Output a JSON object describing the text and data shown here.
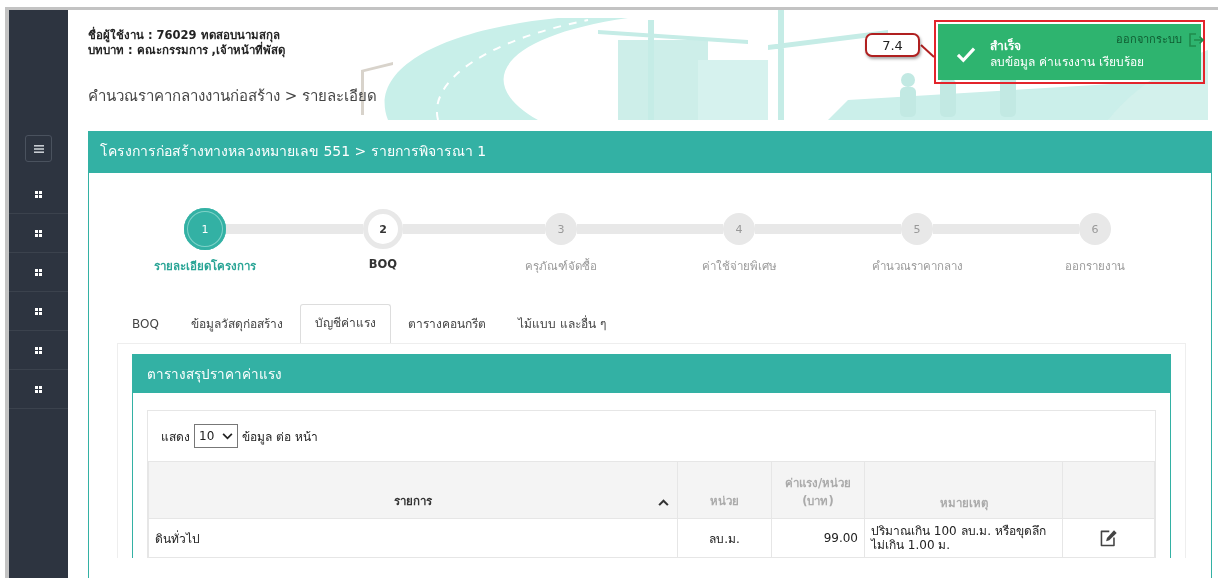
{
  "user": {
    "name_label": "ชื่อผู้ใช้งาน : 76029 ทดสอบนามสกุล",
    "role_label": "บทบาท : คณะกรรมการ ,เจ้าหน้าที่พัสดุ"
  },
  "breadcrumb": "คำนวณราคากลางงานก่อสร้าง > รายละเอียด",
  "logout": "ออกจากระบบ",
  "toast": {
    "title": "สำเร็จ",
    "message": "ลบข้อมูล ค่าแรงงาน เรียบร้อย"
  },
  "annotation": {
    "label": "7.4"
  },
  "panel": {
    "title": "โครงการก่อสร้างทางหลวงหมายเลข 551 > รายการพิจารณา 1"
  },
  "steps": [
    {
      "number": "1",
      "label": "รายละเอียดโครงการ",
      "selected": true,
      "disabled": false
    },
    {
      "number": "2",
      "label": "BOQ",
      "selected": false,
      "disabled": false
    },
    {
      "number": "3",
      "label": "ครุภัณฑ์จัดซื้อ",
      "selected": false,
      "disabled": true
    },
    {
      "number": "4",
      "label": "ค่าใช้จ่ายพิเศษ",
      "selected": false,
      "disabled": true
    },
    {
      "number": "5",
      "label": "คำนวณราคากลาง",
      "selected": false,
      "disabled": true
    },
    {
      "number": "6",
      "label": "ออกรายงาน",
      "selected": false,
      "disabled": true
    }
  ],
  "tabs": [
    {
      "label": "BOQ",
      "selected": false
    },
    {
      "label": "ข้อมูลวัสดุก่อสร้าง",
      "selected": false
    },
    {
      "label": "บัญชีค่าแรง",
      "selected": true
    },
    {
      "label": "ตารางคอนกรีต",
      "selected": false
    },
    {
      "label": "ไม้แบบ และอื่น ๆ",
      "selected": false
    }
  ],
  "labour_panel": {
    "title": "ตารางสรุปราคาค่าแรง",
    "page_size": {
      "prefix": "แสดง",
      "value": "10",
      "suffix": "ข้อมูล ต่อ หน้า"
    },
    "columns": [
      {
        "label": "รายการ",
        "sorted": true
      },
      {
        "label": "หน่วย",
        "sorted": false
      },
      {
        "label": "ค่าแรง/หน่วย (บาท)",
        "sorted": false
      },
      {
        "label": "หมายเหตุ",
        "sorted": false
      }
    ],
    "rows": [
      {
        "cells": [
          "ดินทั่วไป",
          "ลบ.ม.",
          "99.00",
          "ปริมาณเกิน 100 ลบ.ม. หรือขุดลึกไม่เกิน 1.00 ม."
        ],
        "editable": true
      }
    ]
  }
}
